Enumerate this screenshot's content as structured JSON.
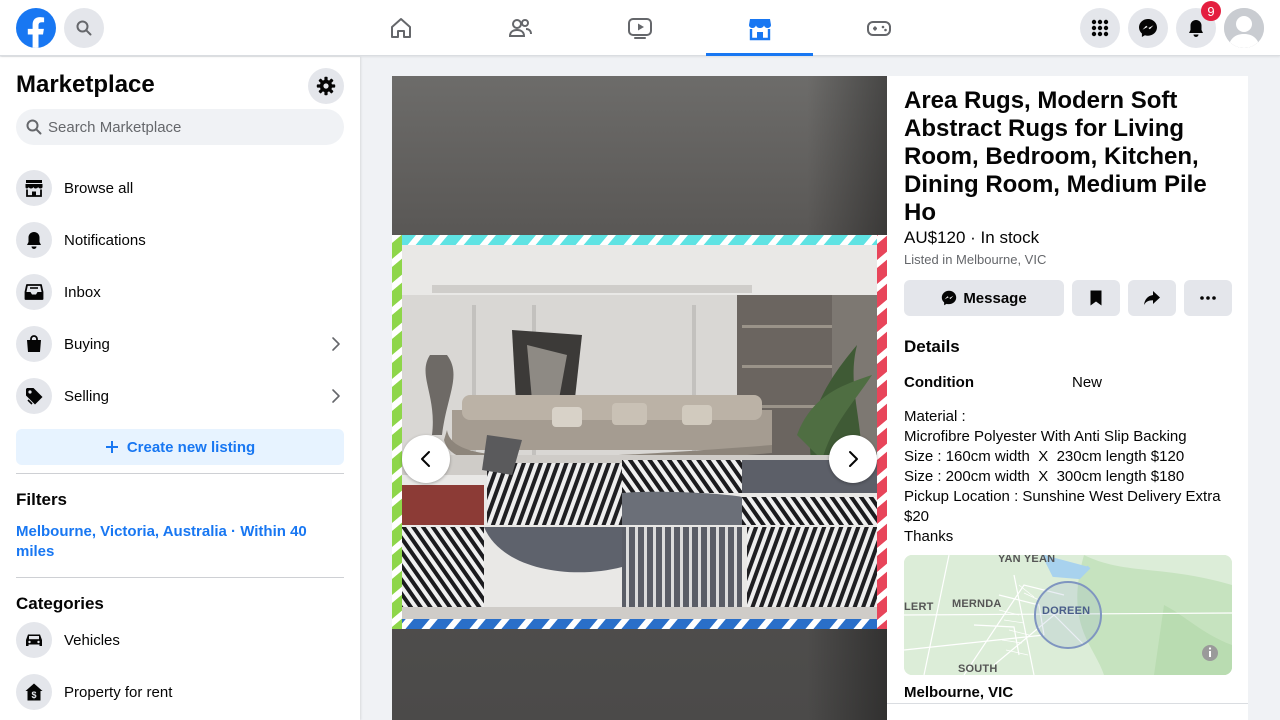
{
  "topbar": {
    "notification_count": "9",
    "nav_tabs": [
      "home",
      "friends",
      "watch",
      "marketplace",
      "gaming"
    ],
    "active_tab": "marketplace"
  },
  "sidebar": {
    "title": "Marketplace",
    "search_placeholder": "Search Marketplace",
    "items": [
      {
        "label": "Browse all",
        "icon": "storefront-icon"
      },
      {
        "label": "Notifications",
        "icon": "bell-icon"
      },
      {
        "label": "Inbox",
        "icon": "inbox-icon"
      },
      {
        "label": "Buying",
        "icon": "shopping-bag-icon"
      },
      {
        "label": "Selling",
        "icon": "price-tag-icon"
      }
    ],
    "create_listing": "Create new listing",
    "filters_heading": "Filters",
    "filter_location": "Melbourne, Victoria, Australia · Within 40 miles",
    "categories_heading": "Categories",
    "categories": [
      {
        "label": "Vehicles",
        "icon": "car-icon"
      },
      {
        "label": "Property for rent",
        "icon": "house-dollar-icon"
      }
    ]
  },
  "listing": {
    "title": "Area Rugs, Modern Soft Abstract Rugs for Living Room, Bedroom, Kitchen, Dining Room, Medium Pile Ho",
    "price_stock": "AU$120 · In stock",
    "listed_in": "Listed in Melbourne, VIC",
    "message_label": "Message",
    "details_heading": "Details",
    "condition_label": "Condition",
    "condition_value": "New",
    "description_lines": [
      "Material :",
      "Microfibre Polyester With Anti Slip Backing",
      "Size : 160cm width  X  230cm length $120",
      "Size : 200cm width  X  300cm length $180",
      "Pickup Location : Sunshine West Delivery Extra $20",
      "Thanks"
    ],
    "map_labels": [
      "YAN YEAN",
      "MERNDA",
      "DOREEN",
      "LERT",
      "SOUTH"
    ],
    "location": "Melbourne, VIC"
  },
  "colors": {
    "brand": "#1877f2",
    "badge": "#e41e3f"
  }
}
